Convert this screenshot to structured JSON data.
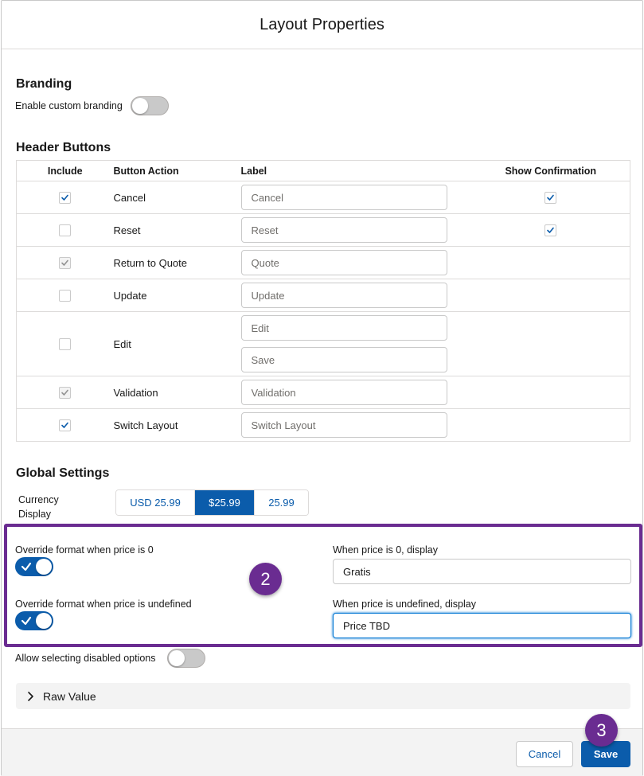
{
  "modal": {
    "title": "Layout Properties"
  },
  "branding": {
    "title": "Branding",
    "custom_branding_label": "Enable custom branding",
    "custom_branding_on": false
  },
  "header_buttons": {
    "title": "Header Buttons",
    "columns": [
      "Include",
      "Button Action",
      "Label",
      "Show Confirmation"
    ],
    "rows": [
      {
        "action": "Cancel",
        "include": true,
        "include_disabled": false,
        "labels": [
          "Cancel"
        ],
        "show_confirmation": true
      },
      {
        "action": "Reset",
        "include": false,
        "include_disabled": false,
        "labels": [
          "Reset"
        ],
        "show_confirmation": true
      },
      {
        "action": "Return to Quote",
        "include": true,
        "include_disabled": true,
        "labels": [
          "Quote"
        ],
        "show_confirmation": null
      },
      {
        "action": "Update",
        "include": false,
        "include_disabled": false,
        "labels": [
          "Update"
        ],
        "show_confirmation": null
      },
      {
        "action": "Edit",
        "include": false,
        "include_disabled": false,
        "labels": [
          "Edit",
          "Save"
        ],
        "show_confirmation": null
      },
      {
        "action": "Validation",
        "include": true,
        "include_disabled": true,
        "labels": [
          "Validation"
        ],
        "show_confirmation": null
      },
      {
        "action": "Switch Layout",
        "include": true,
        "include_disabled": false,
        "labels": [
          "Switch Layout"
        ],
        "show_confirmation": null
      }
    ]
  },
  "global_settings": {
    "title": "Global Settings",
    "currency_label_line1": "Currency",
    "currency_label_line2": "Display",
    "currency_options": [
      "USD 25.99",
      "$25.99",
      "25.99"
    ],
    "currency_selected": "$25.99",
    "override_zero_label": "Override format when price is 0",
    "override_zero_on": true,
    "override_undefined_label": "Override format when price is undefined",
    "override_undefined_on": true,
    "zero_display_label": "When price is 0, display",
    "zero_display_value": "Gratis",
    "undefined_display_label": "When price is undefined, display",
    "undefined_display_value": "Price TBD",
    "allow_disabled_label": "Allow selecting disabled options",
    "allow_disabled_on": false
  },
  "raw_value": {
    "label": "Raw Value"
  },
  "footer": {
    "cancel_label": "Cancel",
    "save_label": "Save"
  },
  "callouts": {
    "step2": "2",
    "step3": "3"
  },
  "colors": {
    "brand": "#0b5cab",
    "callout": "#6a2c91",
    "toggle_off": "#c9c9c9"
  }
}
